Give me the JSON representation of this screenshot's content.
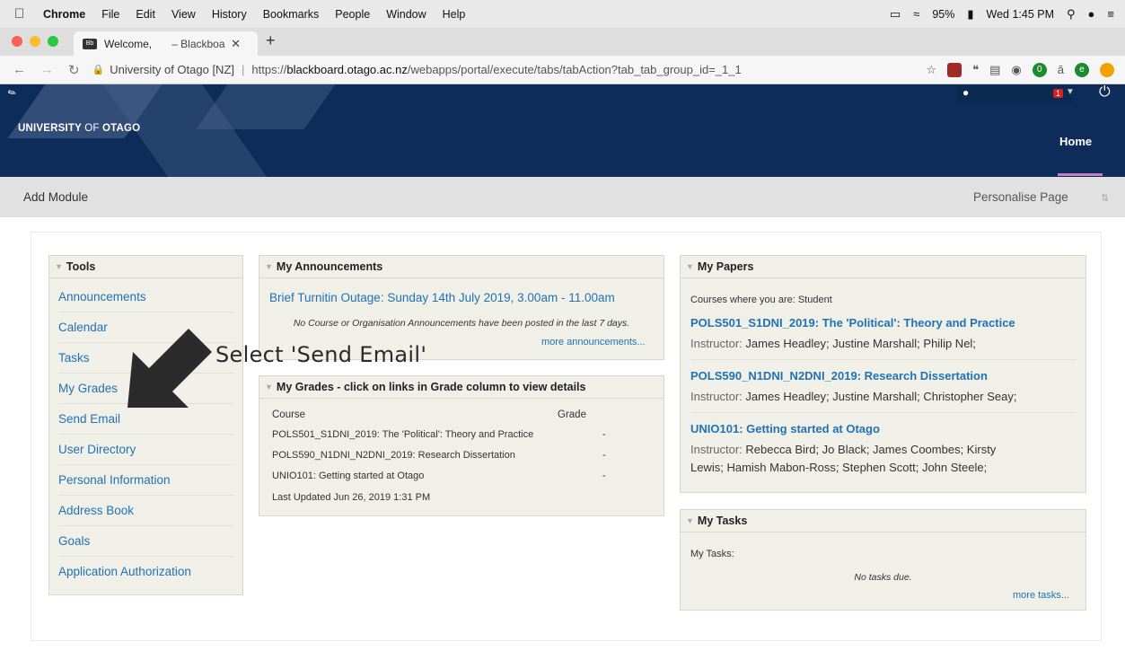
{
  "menubar": {
    "items": [
      "Chrome",
      "File",
      "Edit",
      "View",
      "History",
      "Bookmarks",
      "People",
      "Window",
      "Help"
    ],
    "battery": "95%",
    "clock": "Wed 1:45 PM"
  },
  "tab": {
    "title_left": "Welcome,",
    "title_right": "– Blackboard",
    "favicon": "Bb"
  },
  "address": {
    "site": "University of Otago [NZ]",
    "url_prefix": "https://",
    "url_domain": "blackboard.otago.ac.nz",
    "url_path": "/webapps/portal/execute/tabs/tabAction?tab_tab_group_id=_1_1",
    "ext_badge": "0",
    "ext_letter": "e",
    "ext_amazon": "ā"
  },
  "banner": {
    "logo_left": "UNIVERSITY ",
    "logo_of": "OF",
    "logo_right": " OTAGO",
    "home": "Home",
    "notify_count": "1"
  },
  "modbar": {
    "add": "Add Module",
    "personalise": "Personalise Page"
  },
  "tools": {
    "title": "Tools",
    "items": [
      "Announcements",
      "Calendar",
      "Tasks",
      "My Grades",
      "Send Email",
      "User Directory",
      "Personal Information",
      "Address Book",
      "Goals",
      "Application Authorization"
    ]
  },
  "announcements": {
    "title": "My Announcements",
    "link": "Brief Turnitin Outage: Sunday 14th July 2019, 3.00am - 11.00am",
    "none": "No Course or Organisation Announcements have been posted in the last 7 days.",
    "more": "more announcements..."
  },
  "grades": {
    "title": "My Grades - click on links in Grade column to view details",
    "col_course": "Course",
    "col_grade": "Grade",
    "rows": [
      {
        "course": "POLS501_S1DNI_2019: The 'Political': Theory and Practice",
        "grade": "-"
      },
      {
        "course": "POLS590_N1DNI_N2DNI_2019: Research Dissertation",
        "grade": "-"
      },
      {
        "course": "UNIO101: Getting started at Otago",
        "grade": "-"
      }
    ],
    "updated": "Last Updated Jun 26, 2019 1:31 PM"
  },
  "papers": {
    "title": "My Papers",
    "role": "Courses where you are: Student",
    "instructor_label": "Instructor:",
    "courses": [
      {
        "name": "POLS501_S1DNI_2019: The 'Political': Theory and Practice",
        "instructors": "James Headley;  Justine Marshall;  Philip Nel;"
      },
      {
        "name": "POLS590_N1DNI_N2DNI_2019: Research Dissertation",
        "instructors": "James Headley;  Justine Marshall;  Christopher Seay;"
      },
      {
        "name": "UNIO101: Getting started at Otago",
        "instructors": "Rebecca Bird;  Jo Black;  James Coombes;  Kirsty Lewis;  Hamish Mabon-Ross;  Stephen Scott;  John Steele;"
      }
    ]
  },
  "tasks": {
    "title": "My Tasks",
    "label": "My Tasks:",
    "none": "No tasks due.",
    "more": "more tasks..."
  },
  "overlay": {
    "instruction": "Select 'Send Email'"
  },
  "colors": {
    "link": "#2273b4",
    "banner": "#0e2c5a",
    "module_bg": "#f0efe8"
  }
}
